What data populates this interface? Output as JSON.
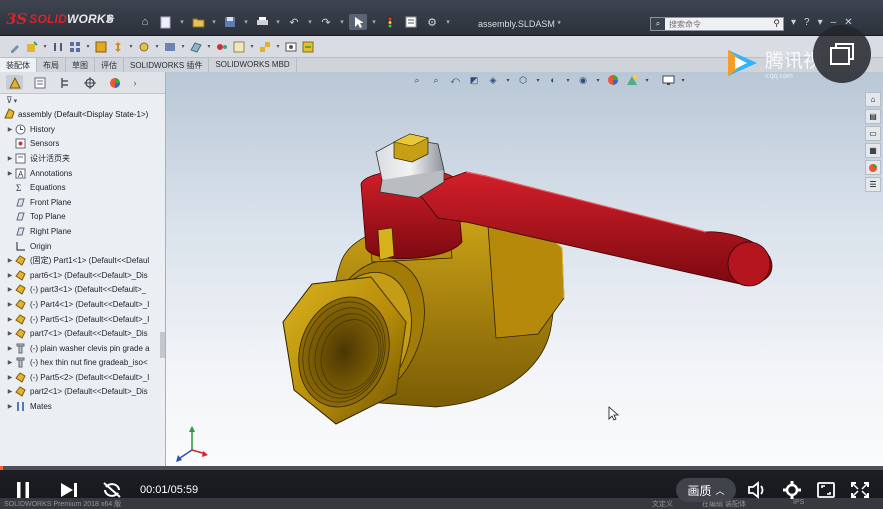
{
  "app": {
    "brand_ds": "3S",
    "brand_solid": "SOLID",
    "brand_works": "WORKS",
    "document_title": "assembly.SLDASM *",
    "search_placeholder": "搜索命令"
  },
  "tabs": [
    "装配体",
    "布局",
    "草图",
    "评估",
    "SOLIDWORKS 插件",
    "SOLIDWORKS MBD"
  ],
  "tree": {
    "root": "assembly  (Default<Display State-1>)",
    "items": [
      {
        "label": "History",
        "icon": "history-icon",
        "expand": true
      },
      {
        "label": "Sensors",
        "icon": "sensor-icon",
        "expand": false
      },
      {
        "label": "设计活页夹",
        "icon": "binder-icon",
        "expand": true
      },
      {
        "label": "Annotations",
        "icon": "annotation-icon",
        "expand": true
      },
      {
        "label": "Equations",
        "icon": "equation-icon",
        "expand": false
      },
      {
        "label": "Front Plane",
        "icon": "plane-icon",
        "expand": false
      },
      {
        "label": "Top Plane",
        "icon": "plane-icon",
        "expand": false
      },
      {
        "label": "Right Plane",
        "icon": "plane-icon",
        "expand": false
      },
      {
        "label": "Origin",
        "icon": "origin-icon",
        "expand": false
      },
      {
        "label": "(固定) Part1<1> (Default<<Defaul",
        "icon": "part-icon",
        "expand": true
      },
      {
        "label": "part6<1> (Default<<Default>_Dis",
        "icon": "part-icon",
        "expand": true
      },
      {
        "label": "(-) part3<1> (Default<<Default>_",
        "icon": "part-icon",
        "expand": true
      },
      {
        "label": "(-) Part4<1> (Default<<Default>_I",
        "icon": "part-icon",
        "expand": true
      },
      {
        "label": "(-) Part5<1> (Default<<Default>_I",
        "icon": "part-icon",
        "expand": true
      },
      {
        "label": "part7<1> (Default<<Default>_Dis",
        "icon": "part-icon",
        "expand": true
      },
      {
        "label": "(-) plain washer clevis pin grade a",
        "icon": "toolbox-part-icon",
        "expand": true
      },
      {
        "label": "(-) hex thin nut fine gradeab_iso<",
        "icon": "toolbox-part-icon",
        "expand": true
      },
      {
        "label": "(-) Part5<2> (Default<<Default>_I",
        "icon": "part-icon",
        "expand": true
      },
      {
        "label": "part2<1> (Default<<Default>_Dis",
        "icon": "part-icon",
        "expand": true
      },
      {
        "label": "Mates",
        "icon": "mates-icon",
        "expand": true
      }
    ]
  },
  "watermark": {
    "name": "腾讯视",
    "sub": "v.qq.com"
  },
  "player": {
    "time": "00:01/05:59",
    "progress": 0.003,
    "quality": "画质",
    "accent": "#ff5c38"
  },
  "status": {
    "left": "SOLIDWORKS Premium 2018 x64 版",
    "mid1": "文定义",
    "mid2": "在编辑 装配体",
    "units": "IPS"
  },
  "colors": {
    "valve_body": "#b8900a",
    "handle": "#c4141f",
    "brand_red": "#d8232a"
  }
}
